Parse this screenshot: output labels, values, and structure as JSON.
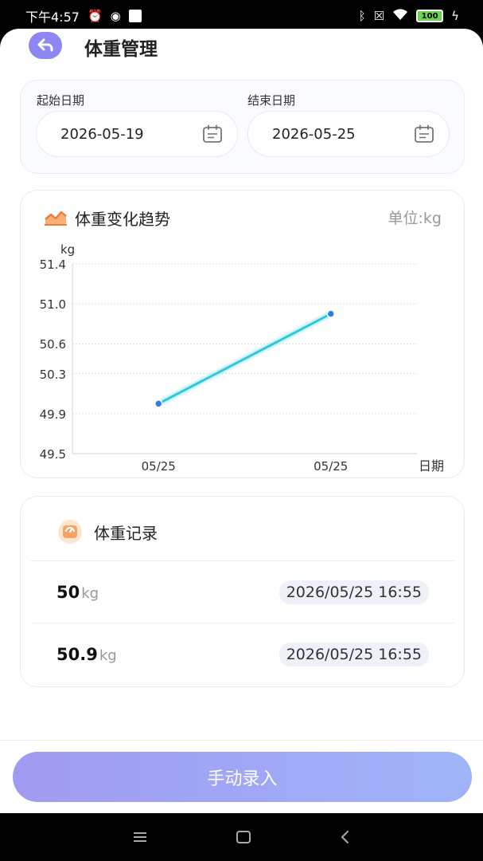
{
  "status_bar": {
    "time": "下午4:57",
    "battery": "100"
  },
  "header": {
    "title": "体重管理"
  },
  "date_range": {
    "start_label": "起始日期",
    "start_value": "2026-05-19",
    "end_label": "结束日期",
    "end_value": "2026-05-25"
  },
  "trend": {
    "title": "体重变化趋势",
    "unit_text": "单位:kg"
  },
  "chart_data": {
    "type": "line",
    "title": "体重变化趋势",
    "ylabel": "kg",
    "xlabel": "日期",
    "categories": [
      "05/25",
      "05/25"
    ],
    "series": [
      {
        "values": [
          50,
          50.9
        ]
      }
    ],
    "yticks": [
      "49.5",
      "49.9",
      "50.3",
      "50.6",
      "51.0",
      "51.4"
    ],
    "ylim": [
      49.5,
      51.4
    ],
    "grid": true,
    "colors": {
      "line": "#27c6d9",
      "point": "#2e7fe0"
    }
  },
  "records": {
    "title": "体重记录",
    "items": [
      {
        "weight": "50",
        "unit": "kg",
        "time": "2026/05/25 16:55"
      },
      {
        "weight": "50.9",
        "unit": "kg",
        "time": "2026/05/25 16:55"
      }
    ]
  },
  "footer": {
    "button_label": "手动录入"
  },
  "theme": {
    "accent": "#8e86f2",
    "button_gradient_start": "#a19af2",
    "button_gradient_end": "#9fb4f8"
  }
}
